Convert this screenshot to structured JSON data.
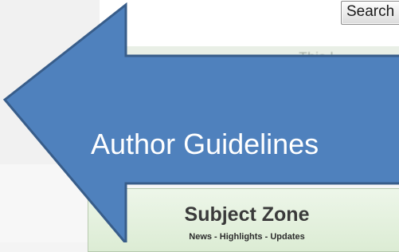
{
  "search": {
    "button_label": "Search"
  },
  "background": {
    "faded_text": "· · · ·   This l"
  },
  "subject_zone": {
    "title": "Subject Zone",
    "subtitle": "News - Highlights - Updates"
  },
  "callout": {
    "label": "Author Guidelines",
    "fill_color": "#4f81bd",
    "border_color": "#385d8a"
  }
}
